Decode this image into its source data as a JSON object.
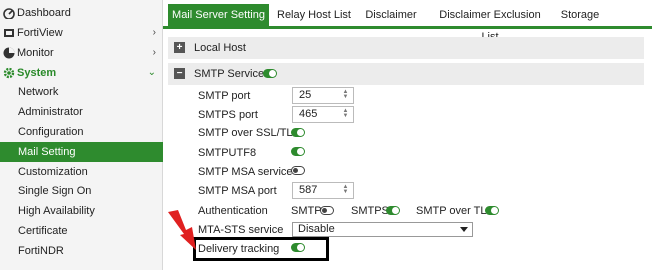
{
  "sidebar": {
    "items": [
      {
        "label": "Dashboard",
        "icon": "dashboard-icon",
        "chevron": ""
      },
      {
        "label": "FortiView",
        "icon": "fortiview-icon",
        "chevron": "›"
      },
      {
        "label": "Monitor",
        "icon": "monitor-icon",
        "chevron": "›"
      },
      {
        "label": "System",
        "icon": "gear-icon",
        "chevron": "⌄"
      },
      {
        "label": "Network"
      },
      {
        "label": "Administrator"
      },
      {
        "label": "Configuration"
      },
      {
        "label": "Mail Setting"
      },
      {
        "label": "Customization"
      },
      {
        "label": "Single Sign On"
      },
      {
        "label": "High Availability"
      },
      {
        "label": "Certificate"
      },
      {
        "label": "FortiNDR"
      }
    ]
  },
  "tabs": [
    "Mail Server Setting",
    "Relay Host List",
    "Disclaimer",
    "Disclaimer Exclusion List",
    "Storage"
  ],
  "sections": {
    "local_host": "Local Host",
    "smtp_service": "SMTP Service"
  },
  "smtp": {
    "smtp_port_label": "SMTP port",
    "smtp_port_value": "25",
    "smtps_port_label": "SMTPS port",
    "smtps_port_value": "465",
    "smtp_ssl_tls_label": "SMTP over SSL/TLS",
    "smtputf8_label": "SMTPUTF8",
    "msa_service_label": "SMTP MSA service",
    "msa_port_label": "SMTP MSA port",
    "msa_port_value": "587",
    "auth_label": "Authentication",
    "auth_smtp": "SMTP",
    "auth_smtps": "SMTPS",
    "auth_smtp_tls": "SMTP over TLS",
    "mta_sts_label": "MTA-STS service",
    "mta_sts_value": "Disable",
    "delivery_tracking_label": "Delivery tracking"
  },
  "colors": {
    "accent": "#2e8b2e",
    "annotation_arrow": "#e02020",
    "annotation_box": "#000000"
  }
}
